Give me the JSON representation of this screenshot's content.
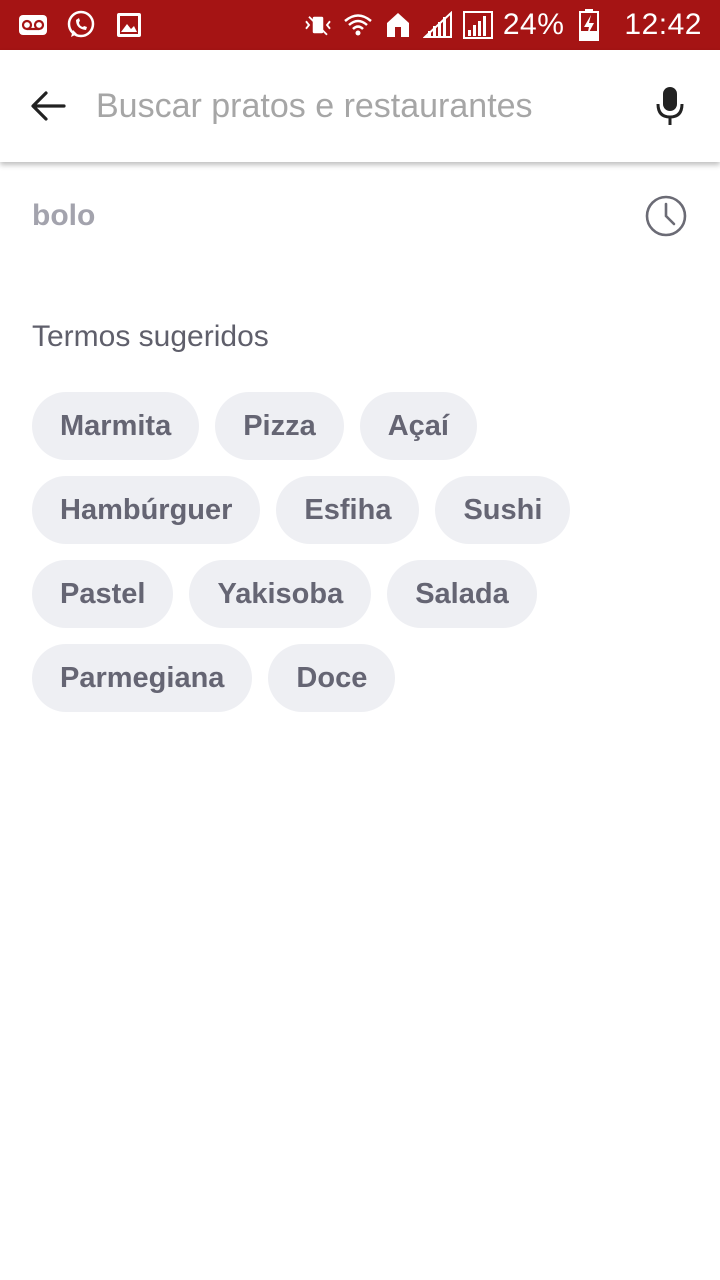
{
  "status_bar": {
    "battery": "24%",
    "time": "12:42",
    "bg_color": "#a51414",
    "icons_left": [
      "voicemail-icon",
      "whatsapp-icon",
      "image-icon"
    ],
    "icons_right": [
      "vibrate-icon",
      "wifi-icon",
      "home-icon",
      "signal-icon",
      "signal-icon",
      "battery-charging-icon"
    ]
  },
  "search": {
    "placeholder": "Buscar pratos e restaurantes",
    "value": ""
  },
  "history": {
    "items": [
      {
        "label": "bolo",
        "icon": "clock-icon"
      }
    ]
  },
  "suggested": {
    "title": "Termos sugeridos",
    "rows": [
      [
        "Marmita",
        "Pizza",
        "Açaí"
      ],
      [
        "Hambúrguer",
        "Esfiha",
        "Sushi"
      ],
      [
        "Pastel",
        "Yakisoba",
        "Salada"
      ],
      [
        "Parmegiana",
        "Doce"
      ]
    ]
  }
}
